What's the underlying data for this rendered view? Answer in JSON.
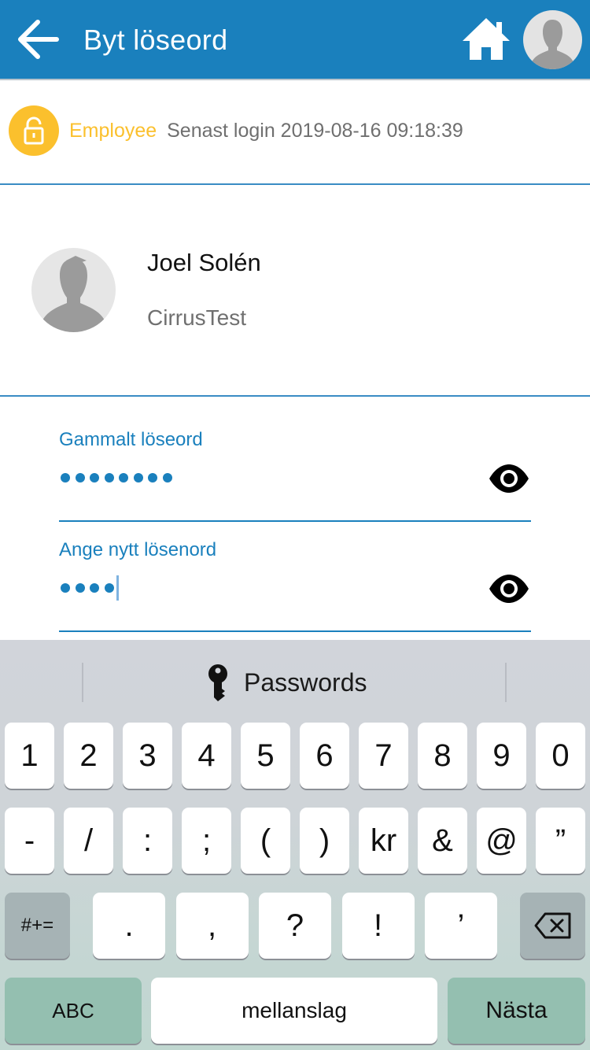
{
  "header": {
    "title": "Byt löseord",
    "background": "#1a80bd"
  },
  "login_info": {
    "role": "Employee",
    "last_login": "Senast login 2019-08-16 09:18:39",
    "role_color": "#fbc02d"
  },
  "profile": {
    "name": "Joel Solén",
    "company": "CirrusTest"
  },
  "fields": [
    {
      "label": "Gammalt löseord",
      "masked_length": 8,
      "focused": false
    },
    {
      "label": "Ange nytt lösenord",
      "masked_length": 4,
      "focused": true
    }
  ],
  "keyboard": {
    "suggestion": "Passwords",
    "rows": [
      [
        "1",
        "2",
        "3",
        "4",
        "5",
        "6",
        "7",
        "8",
        "9",
        "0"
      ],
      [
        "-",
        "/",
        ":",
        ";",
        "(",
        ")",
        "kr",
        "&",
        "@",
        "”"
      ],
      [
        ".",
        ",",
        "?",
        "!",
        "’"
      ]
    ],
    "symbols_key": "#+=",
    "abc_key": "ABC",
    "space_key": "mellanslag",
    "next_key": "Nästa"
  },
  "icons": {
    "back": "arrow-left-icon",
    "home": "home-icon",
    "lock": "lock-icon",
    "eye": "eye-icon",
    "key": "key-icon",
    "backspace": "backspace-icon",
    "avatar": "person-silhouette-icon"
  }
}
